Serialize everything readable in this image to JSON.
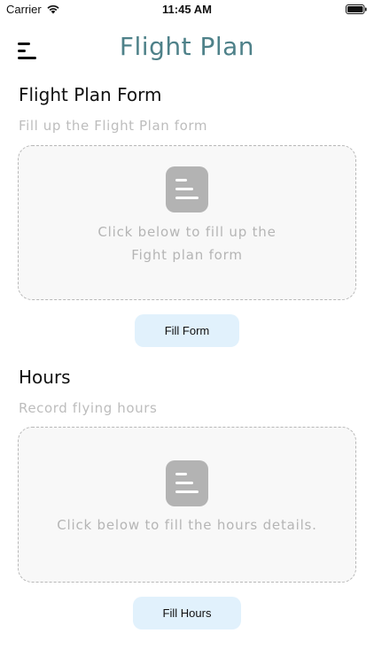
{
  "status_bar": {
    "carrier": "Carrier",
    "time": "11:45 AM"
  },
  "header": {
    "title": "Flight Plan",
    "menu_icon": "hamburger-menu-icon"
  },
  "sections": [
    {
      "title": "Flight Plan Form",
      "subtitle": "Fill up the Flight Plan form",
      "card_line1": "Click below to fill up the",
      "card_line2": "Fight plan form",
      "icon": "document-icon",
      "button_label": "Fill Form"
    },
    {
      "title": "Hours",
      "subtitle": "Record flying hours",
      "card_line1": "Click below to fill the hours details.",
      "icon": "document-icon",
      "button_label": "Fill Hours"
    }
  ],
  "colors": {
    "title": "#4e8189",
    "button_bg": "#e1f1fc",
    "card_bg": "#f8f8f8",
    "muted_text": "#bdbdbd"
  }
}
